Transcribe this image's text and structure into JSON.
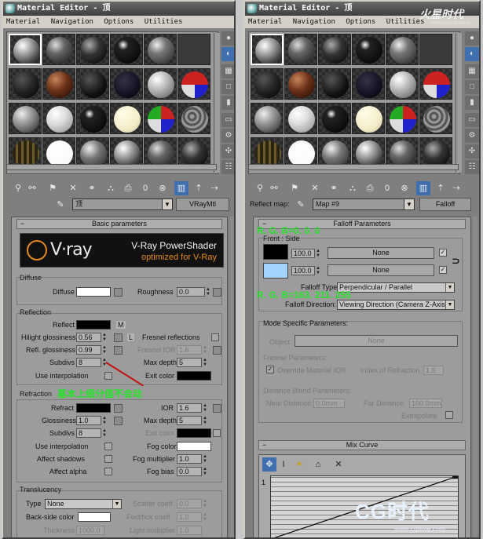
{
  "left": {
    "title": "Material Editor - 顶",
    "menu": [
      "Material",
      "Navigation",
      "Options",
      "Utilities"
    ],
    "material_name": "顶",
    "material_type": "VRayMtl",
    "rollout_basic": "Basic parameters",
    "banner": {
      "logo": "V·ray",
      "title": "V-Ray PowerShader",
      "subtitle": "optimized for V-Ray"
    },
    "diffuse": {
      "header": "Diffuse",
      "diffuse_label": "Diffuse",
      "roughness_label": "Roughness",
      "roughness": "0.0"
    },
    "reflection": {
      "header": "Reflection",
      "reflect_label": "Reflect",
      "m_label": "M",
      "hilight_label": "Hilight glossiness",
      "hilight": "0.56",
      "l_label": "L",
      "fresnel_label": "Fresnel reflections",
      "refl_gloss_label": "Refl. glossiness",
      "refl_gloss": "0.99",
      "fresnel_ior_label": "Fresnel IOR",
      "fresnel_ior": "1.6",
      "subdivs_label": "Subdivs",
      "subdivs": "8",
      "max_depth_label": "Max depth",
      "max_depth": "5",
      "use_interp_label": "Use interpolation",
      "exit_color_label": "Exit color"
    },
    "annotation": "基本上细分值不会动",
    "refraction": {
      "header": "Refraction",
      "refract_label": "Refract",
      "ior_label": "IOR",
      "ior": "1.6",
      "glossiness_label": "Glossiness",
      "glossiness": "1.0",
      "max_depth_label": "Max depth",
      "max_depth": "5",
      "subdivs_label": "Subdivs",
      "subdivs": "8",
      "exit_color_label": "Exit color",
      "use_interp_label": "Use interpolation",
      "fog_color_label": "Fog color",
      "affect_shadows_label": "Affect shadows",
      "fog_mult_label": "Fog multiplier",
      "fog_mult": "1.0",
      "affect_alpha_label": "Affect alpha",
      "fog_bias_label": "Fog bias",
      "fog_bias": "0.0"
    },
    "translucency": {
      "header": "Translucency",
      "type_label": "Type",
      "type_value": "None",
      "scatter_label": "Scatter coeff",
      "scatter": "0.0",
      "backside_label": "Back-side color",
      "fwd_label": "Fwd/bck coeff",
      "fwd": "1.0",
      "thickness_label": "Thickness",
      "thickness": "1000.0",
      "light_mult_label": "Light multiplier",
      "light_mult": "1.0"
    }
  },
  "right": {
    "title": "Material Editor - 顶",
    "menu": [
      "Material",
      "Navigation",
      "Options",
      "Utilities"
    ],
    "reflect_map_label": "Reflect map:",
    "map_name": "Map #9",
    "map_type": "Falloff",
    "rollout_falloff": "Falloff Parameters",
    "front_side_label": "Front : Side",
    "value1": "100.0",
    "value2": "100.0",
    "none1": "None",
    "none2": "None",
    "annotation_black": "R. G. B=0. 0. 0",
    "annotation_blue": "R. G. B=163. 211. 255",
    "falloff_type_label": "Falloff Type:",
    "falloff_type_value": "Perpendicular / Parallel",
    "falloff_dir_label": "Falloff Direction:",
    "falloff_dir_value": "Viewing Direction (Camera Z-Axis)",
    "mode_specific_label": "Mode Specific Parameters:",
    "object_label": "Object:",
    "object_value": "None",
    "fresnel_params_label": "Fresnel Parameters:",
    "override_ior_label": "Override Material IOR",
    "index_refraction_label": "Index of Refraction",
    "index_refraction": "1.6",
    "distance_blend_label": "Distance Blend Parameters:",
    "near_distance_label": "Near Distance:",
    "near_distance": "0.0mm",
    "far_distance_label": "Far Distance:",
    "far_distance": "100.0mm",
    "extrapolate_label": "Extrapolate",
    "rollout_mix": "Mix Curve",
    "curve_point_label": "1",
    "watermark_top": "火星时代",
    "watermark_top_url": "www.hxsd.com",
    "watermark_bottom": "CG时代",
    "watermark_bottom_url": "www.cgtime.com"
  },
  "colors": {
    "annotation_green": "#27e22b",
    "arrow_red": "#c41010",
    "vray_orange": "#e38a1a",
    "color_black": "#000000",
    "color_blue": "#a3d3ff",
    "diffuse_white": "#ffffff",
    "fog_white": "#ffffff"
  },
  "icons": [
    "sample-sphere-icon",
    "backlight-icon",
    "background-icon",
    "sample-uv-icon",
    "video-check-icon",
    "make-preview-icon",
    "options-icon",
    "select-by-material-icon",
    "material-map-navigator-icon",
    "get-material-icon",
    "put-to-scene-icon",
    "assign-icon",
    "reset-icon",
    "copy-icon",
    "unique-icon",
    "put-to-library-icon",
    "material-id-icon",
    "show-map-icon",
    "show-end-icon",
    "go-parent-icon",
    "go-sibling-icon",
    "pick-icon"
  ]
}
